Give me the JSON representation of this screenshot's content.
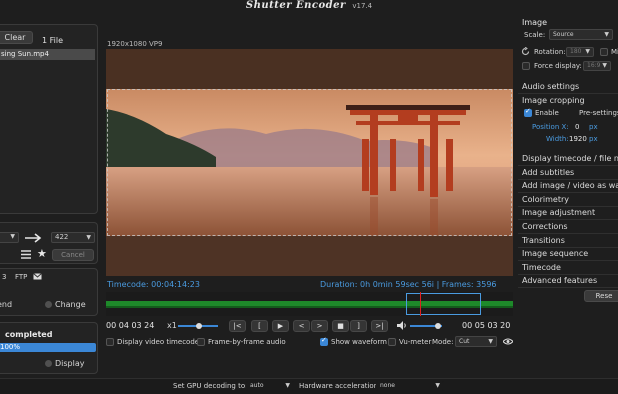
{
  "app": {
    "title": "Shutter Encoder",
    "version": "v17.4"
  },
  "files": {
    "clear_label": "Clear",
    "count_label": "1 File",
    "items": [
      "sing Sun.mp4"
    ]
  },
  "convert": {
    "left_value": "",
    "right_value": "422",
    "cancel_label": "Cancel"
  },
  "output": {
    "tab_label": "t 3",
    "ftp_label": "FTP",
    "send_label": "end",
    "change_label": "Change"
  },
  "progress": {
    "status": "completed",
    "percent_label": "100%",
    "percent": 100,
    "display_label": "Display"
  },
  "viewer": {
    "info": "1920x1080 VP9",
    "timecode": "Timecode: 00:04:14:23",
    "duration": "Duration: 0h 0min 59sec 56i | Frames: 3596",
    "tc_left": "00 04 03 24",
    "speed": "x1",
    "tc_right": "00 05 03 20",
    "controls": [
      "|<",
      "[",
      "▶",
      "<",
      ">",
      "■",
      "]",
      ">|"
    ],
    "display_video_timecode": "Display video timecode",
    "frame_by_frame_audio": "Frame-by-frame audio",
    "show_waveform": "Show waveform",
    "vu_meter": "Vu-meter",
    "mode_label": "Mode:",
    "mode_value": "Cut"
  },
  "settings": {
    "image_header": "Image",
    "scale_label": "Scale:",
    "scale_value": "Source",
    "rotation_label": "Rotation:",
    "rotation_value": "180",
    "mi_label": "Mi",
    "force_label": "Force display:",
    "force_value": "16:9",
    "audio_settings": "Audio settings",
    "image_cropping": "Image cropping",
    "enable_label": "Enable",
    "presettings_label": "Pre-settings",
    "position_label": "Position X:",
    "position_value": "0",
    "position_unit": "px",
    "width_label": "Width:",
    "width_value": "1920",
    "width_unit": "px",
    "sections": [
      "Display timecode / file name",
      "Add subtitles",
      "Add image / video as watermark",
      "Colorimetry",
      "Image adjustment",
      "Corrections",
      "Transitions",
      "Image sequence",
      "Timecode",
      "Advanced features"
    ],
    "reset_label": "Rese"
  },
  "bottom": {
    "gpu_label": "Set GPU decoding to:",
    "gpu_value": "auto",
    "hw_label": "Hardware acceleration:",
    "hw_value": "none"
  },
  "colors": {
    "accent": "#3b87d6",
    "timecode": "#4a9be0",
    "waveform": "#1e8a2a"
  }
}
